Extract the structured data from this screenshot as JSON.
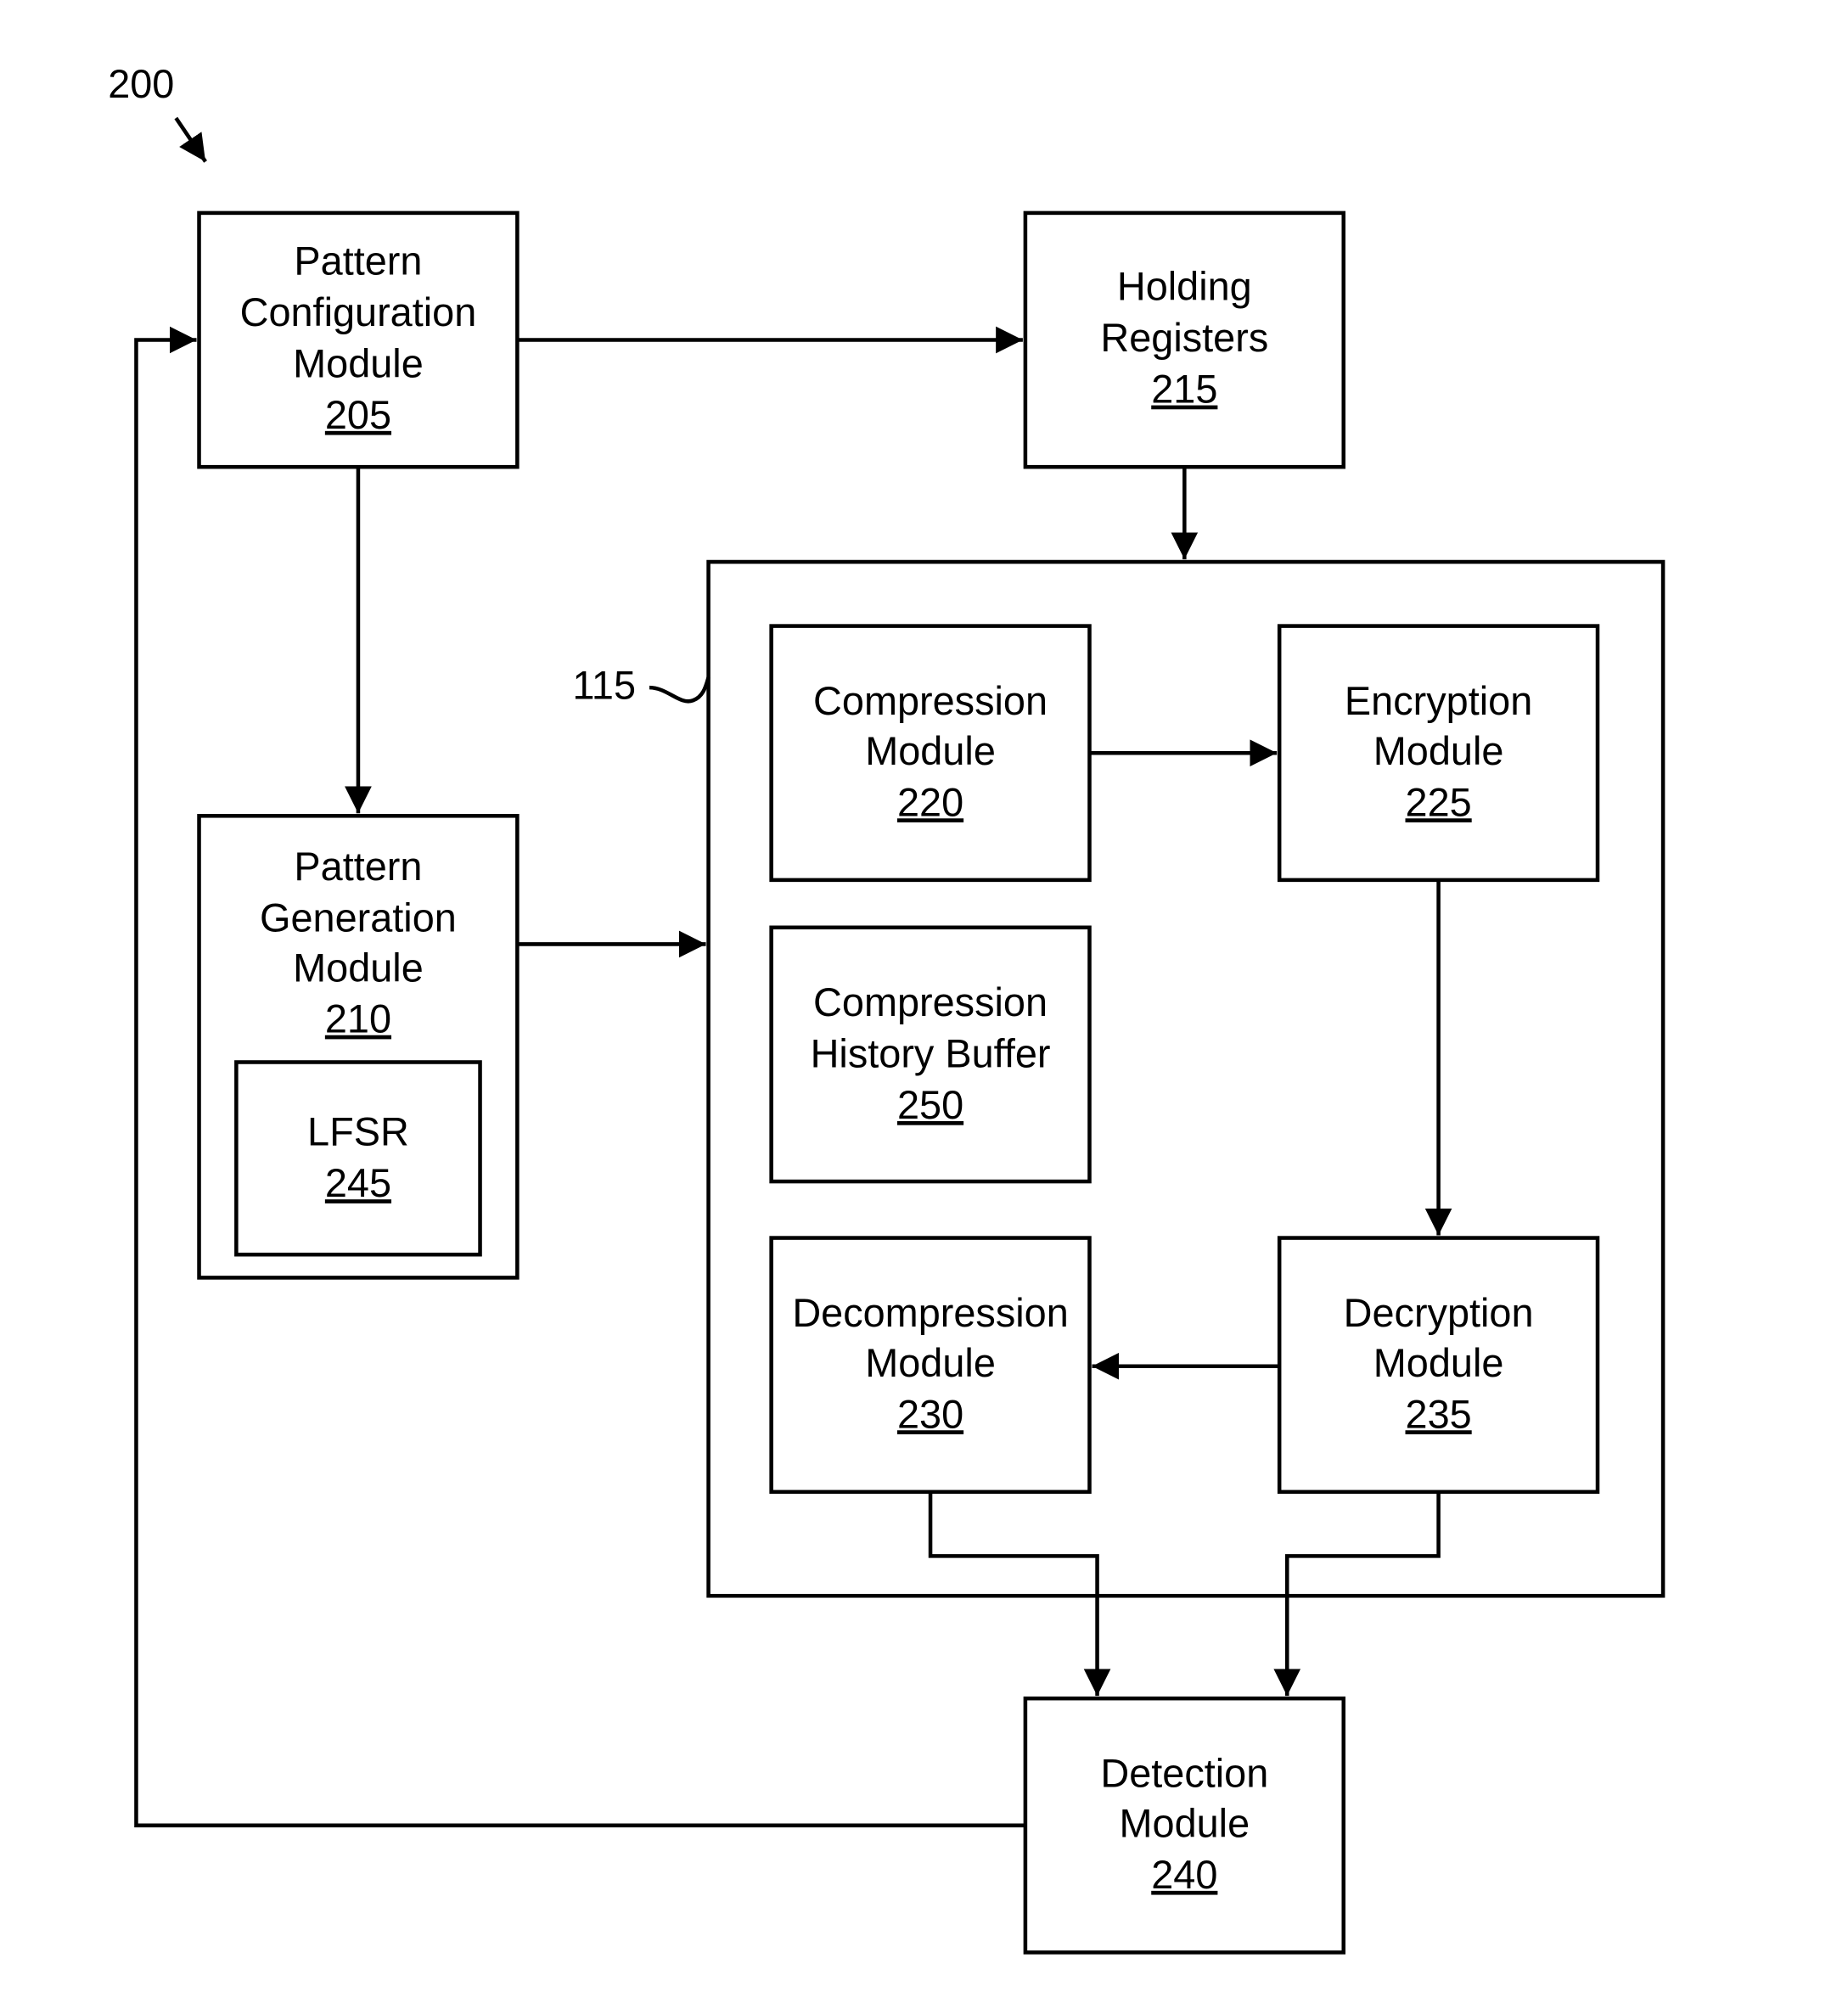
{
  "figure": {
    "number": "200",
    "container_ref": "115"
  },
  "blocks": {
    "pattern_config": {
      "lines": [
        "Pattern",
        "Configuration",
        "Module"
      ],
      "ref": "205"
    },
    "holding_registers": {
      "lines": [
        "Holding",
        "Registers"
      ],
      "ref": "215"
    },
    "pattern_generation": {
      "lines": [
        "Pattern",
        "Generation",
        "Module"
      ],
      "ref": "210"
    },
    "lfsr": {
      "lines": [
        "LFSR"
      ],
      "ref": "245"
    },
    "compression": {
      "lines": [
        "Compression",
        "Module"
      ],
      "ref": "220"
    },
    "encryption": {
      "lines": [
        "Encryption",
        "Module"
      ],
      "ref": "225"
    },
    "history_buffer": {
      "lines": [
        "Compression",
        "History Buffer"
      ],
      "ref": "250"
    },
    "decompression": {
      "lines": [
        "Decompression",
        "Module"
      ],
      "ref": "230"
    },
    "decryption": {
      "lines": [
        "Decryption",
        "Module"
      ],
      "ref": "235"
    },
    "detection": {
      "lines": [
        "Detection",
        "Module"
      ],
      "ref": "240"
    }
  },
  "connections": [
    {
      "from": "pattern_config",
      "to": "holding_registers"
    },
    {
      "from": "pattern_config",
      "to": "pattern_generation"
    },
    {
      "from": "holding_registers",
      "to": "container_115"
    },
    {
      "from": "pattern_generation",
      "to": "container_115"
    },
    {
      "from": "compression",
      "to": "encryption"
    },
    {
      "from": "encryption",
      "to": "decryption"
    },
    {
      "from": "decryption",
      "to": "decompression"
    },
    {
      "from": "decompression",
      "to": "detection"
    },
    {
      "from": "decryption",
      "to": "detection"
    },
    {
      "from": "detection",
      "to": "pattern_config"
    }
  ]
}
